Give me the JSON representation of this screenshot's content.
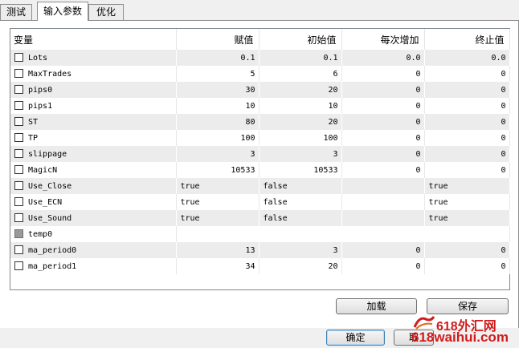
{
  "tabs": [
    {
      "label": "测试"
    },
    {
      "label": "输入参数",
      "active": true
    },
    {
      "label": "优化"
    }
  ],
  "grid": {
    "columns": [
      "变量",
      "赋值",
      "初始值",
      "每次增加",
      "终止值"
    ],
    "rows": [
      {
        "name": "Lots",
        "checked": false,
        "enabled": true,
        "value": "0.1",
        "start": "0.1",
        "step": "0.0",
        "stop": "0.0",
        "kind": "num"
      },
      {
        "name": "MaxTrades",
        "checked": false,
        "enabled": true,
        "value": "5",
        "start": "6",
        "step": "0",
        "stop": "0",
        "kind": "num"
      },
      {
        "name": "pips0",
        "checked": false,
        "enabled": true,
        "value": "30",
        "start": "20",
        "step": "0",
        "stop": "0",
        "kind": "num"
      },
      {
        "name": "pips1",
        "checked": false,
        "enabled": true,
        "value": "10",
        "start": "10",
        "step": "0",
        "stop": "0",
        "kind": "num"
      },
      {
        "name": "ST",
        "checked": false,
        "enabled": true,
        "value": "80",
        "start": "20",
        "step": "0",
        "stop": "0",
        "kind": "num"
      },
      {
        "name": "TP",
        "checked": false,
        "enabled": true,
        "value": "100",
        "start": "100",
        "step": "0",
        "stop": "0",
        "kind": "num"
      },
      {
        "name": "slippage",
        "checked": false,
        "enabled": true,
        "value": "3",
        "start": "3",
        "step": "0",
        "stop": "0",
        "kind": "num"
      },
      {
        "name": "MagicN",
        "checked": false,
        "enabled": true,
        "value": "10533",
        "start": "10533",
        "step": "0",
        "stop": "0",
        "kind": "num"
      },
      {
        "name": "Use_Close",
        "checked": false,
        "enabled": true,
        "value": "true",
        "start": "false",
        "step": "",
        "stop": "true",
        "kind": "txt"
      },
      {
        "name": "Use_ECN",
        "checked": false,
        "enabled": true,
        "value": "true",
        "start": "false",
        "step": "",
        "stop": "true",
        "kind": "txt"
      },
      {
        "name": "Use_Sound",
        "checked": false,
        "enabled": true,
        "value": "true",
        "start": "false",
        "step": "",
        "stop": "true",
        "kind": "txt"
      },
      {
        "name": "temp0",
        "checked": false,
        "enabled": false,
        "value": "",
        "start": "",
        "step": "",
        "stop": "",
        "kind": "span"
      },
      {
        "name": "ma_period0",
        "checked": false,
        "enabled": true,
        "value": "13",
        "start": "3",
        "step": "0",
        "stop": "0",
        "kind": "num"
      },
      {
        "name": "ma_period1",
        "checked": false,
        "enabled": true,
        "value": "34",
        "start": "20",
        "step": "0",
        "stop": "0",
        "kind": "num"
      }
    ]
  },
  "buttons": {
    "load": "加载",
    "save": "保存",
    "ok": "确定",
    "cancel": "取"
  },
  "watermark": {
    "line1": "618外汇网",
    "line2": "618waihui.com"
  },
  "colors": {
    "row_alt": "#ececec",
    "watermark": "#d01c1c"
  }
}
